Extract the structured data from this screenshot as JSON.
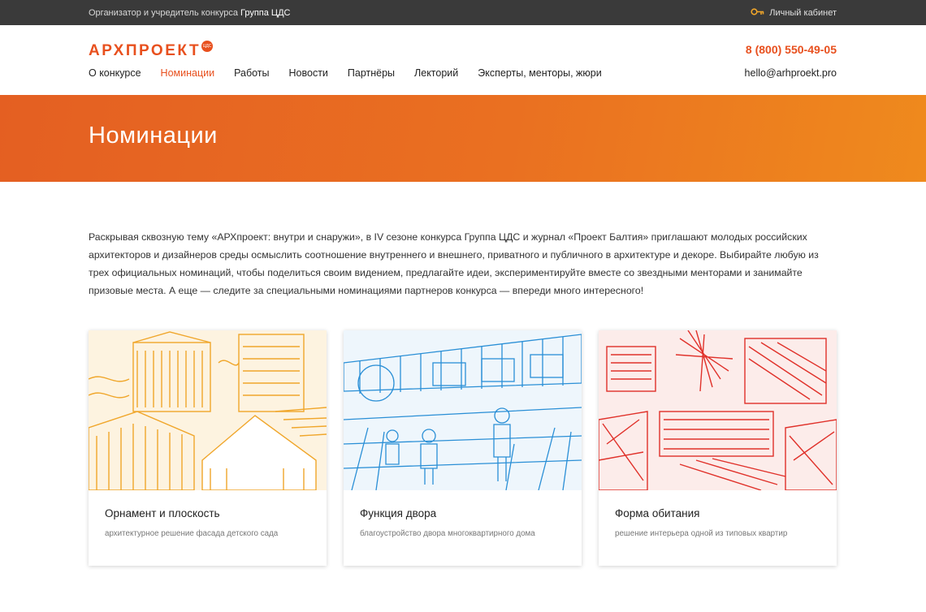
{
  "topbar": {
    "organizer_prefix": "Организатор и учредитель конкурса",
    "organizer_name": "Группа ЦДС",
    "cabinet_label": "Личный кабинет"
  },
  "header": {
    "logo_text": "АРХПРОЕКТ",
    "logo_badge": "ЦДС",
    "phone": "8 (800) 550-49-05",
    "email": "hello@arhproekt.pro",
    "nav": [
      {
        "label": "О конкурсе"
      },
      {
        "label": "Номинации"
      },
      {
        "label": "Работы"
      },
      {
        "label": "Новости"
      },
      {
        "label": "Партнёры"
      },
      {
        "label": "Лекторий"
      },
      {
        "label": "Эксперты, менторы, жюри"
      }
    ]
  },
  "banner": {
    "title": "Номинации"
  },
  "intro": "Раскрывая сквозную тему «АРХпроект: внутри и снаружи», в IV сезоне конкурса Группа ЦДС и журнал «Проект Балтия» приглашают молодых российских архитекторов и дизайнеров среды осмыслить соотношение внутреннего и внешнего, приватного и публичного в архитектуре и декоре. Выбирайте любую из трех официальных номинаций, чтобы поделиться своим видением, предлагайте идеи, экспериментируйте вместе со звездными менторами и занимайте призовые места. А еще — следите за специальными номинациями партнеров конкурса — впереди много интересного!",
  "cards": [
    {
      "title": "Орнамент и плоскость",
      "subtitle": "архитектурное решение фасада детского сада",
      "color": "#f0a62a"
    },
    {
      "title": "Функция двора",
      "subtitle": "благоустройство двора многоквартирного дома",
      "color": "#2a8fd6"
    },
    {
      "title": "Форма обитания",
      "subtitle": "решение интерьера одной из типовых квартир",
      "color": "#e0312a"
    }
  ],
  "colors": {
    "accent": "#e8501e",
    "topbar": "#3a3a3a"
  }
}
